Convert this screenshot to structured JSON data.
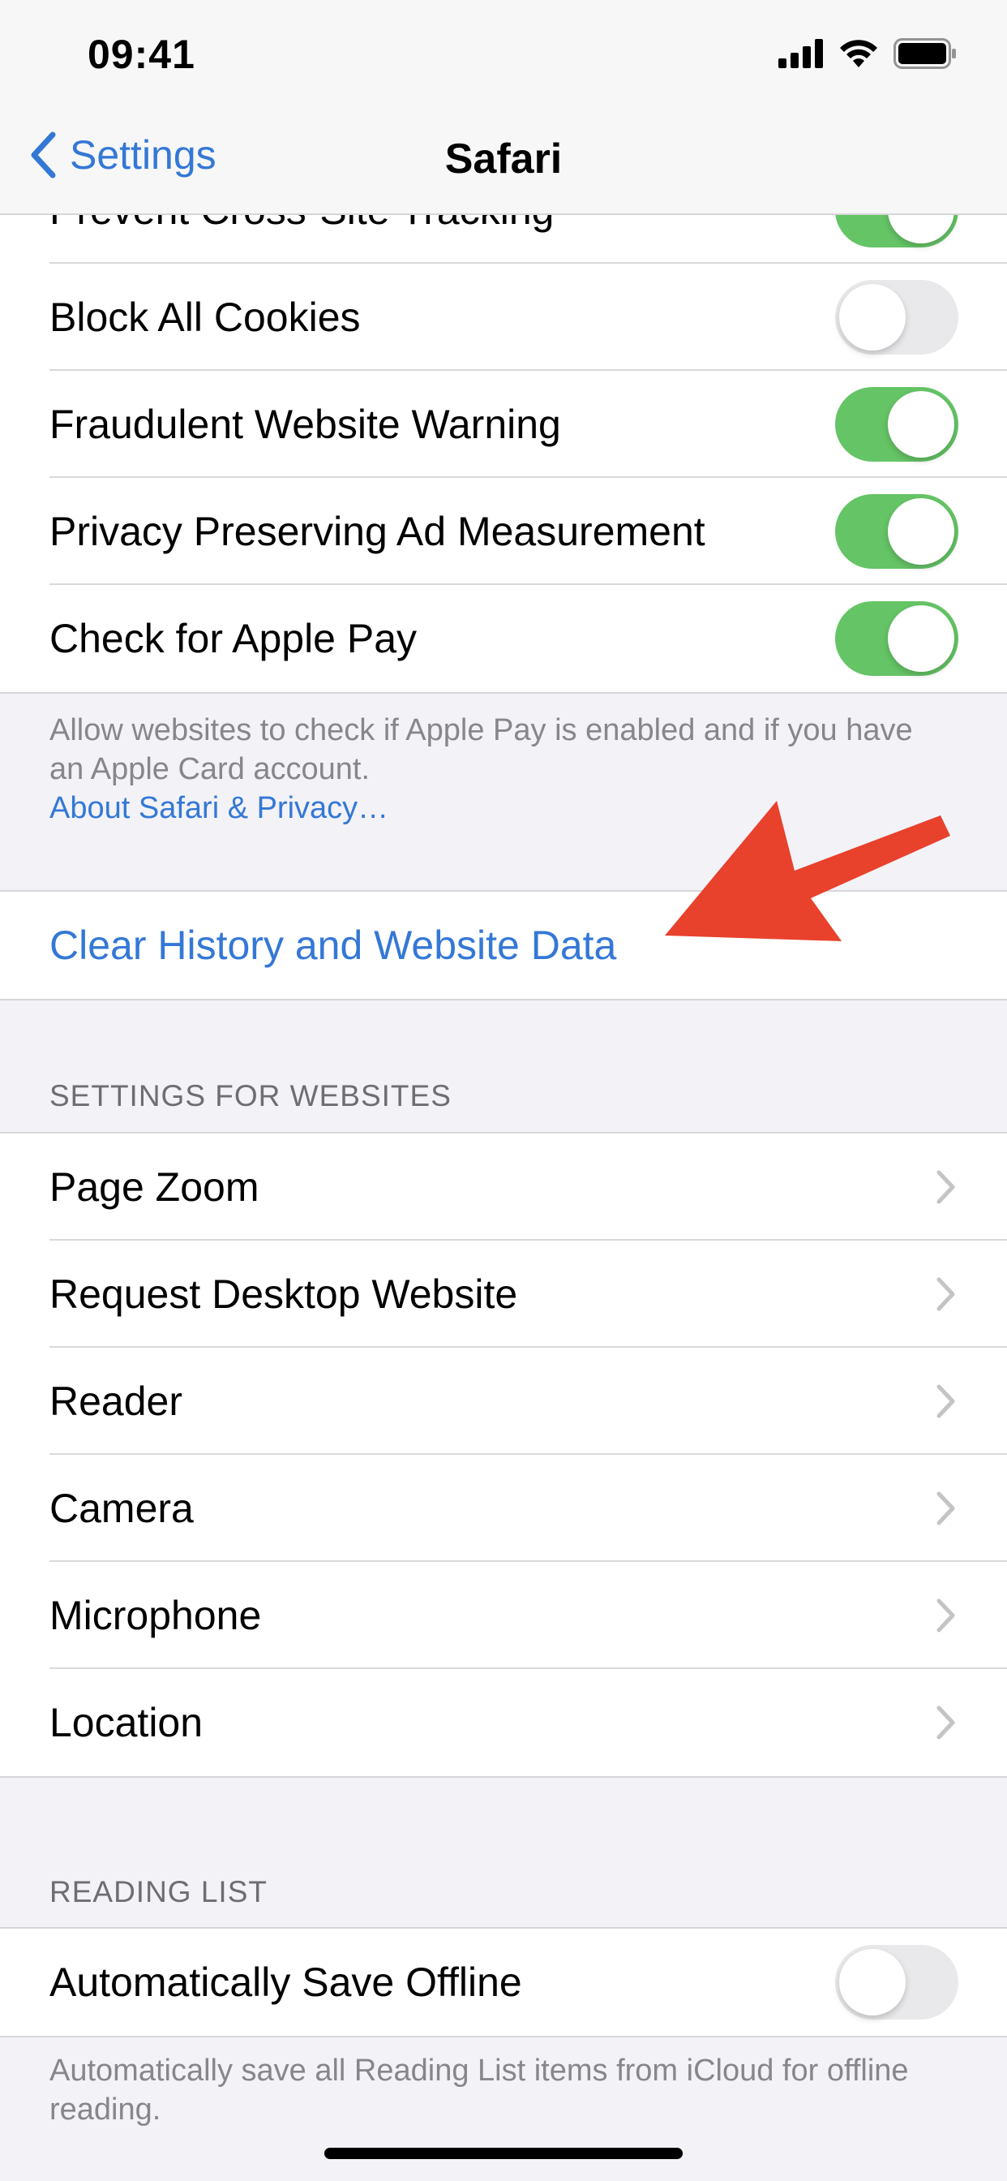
{
  "status_bar": {
    "time": "09:41"
  },
  "nav": {
    "back_label": "Settings",
    "title": "Safari"
  },
  "privacy_section": {
    "rows": [
      {
        "label": "Prevent Cross-Site Tracking",
        "on": true
      },
      {
        "label": "Block All Cookies",
        "on": false
      },
      {
        "label": "Fraudulent Website Warning",
        "on": true
      },
      {
        "label": "Privacy Preserving Ad Measurement",
        "on": true
      },
      {
        "label": "Check for Apple Pay",
        "on": true
      }
    ],
    "footer": "Allow websites to check if Apple Pay is enabled and if you have an Apple Card account.",
    "footer_link": "About Safari & Privacy…"
  },
  "clear_history": {
    "label": "Clear History and Website Data"
  },
  "websites_section": {
    "header": "SETTINGS FOR WEBSITES",
    "rows": [
      {
        "label": "Page Zoom"
      },
      {
        "label": "Request Desktop Website"
      },
      {
        "label": "Reader"
      },
      {
        "label": "Camera"
      },
      {
        "label": "Microphone"
      },
      {
        "label": "Location"
      }
    ]
  },
  "reading_list_section": {
    "header": "READING LIST",
    "rows": [
      {
        "label": "Automatically Save Offline",
        "on": false
      }
    ],
    "footer": "Automatically save all Reading List items from iCloud for offline reading."
  },
  "colors": {
    "accent": "#3478d6",
    "toggle_on": "#65c466",
    "toggle_off": "#e9e9eb",
    "annotation_arrow": "#e8412c",
    "grouped_background": "#f2f2f7"
  }
}
